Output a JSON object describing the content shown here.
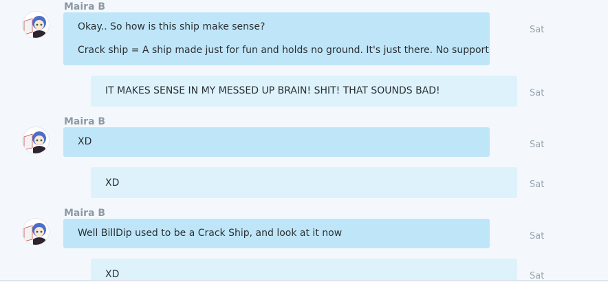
{
  "messages": [
    {
      "sender": "Maira B",
      "lines": [
        "Okay.. So how is this ship make sense?",
        "Crack ship = A ship made just for fun and holds no ground. It's just there. No support"
      ],
      "time": "Sat"
    },
    {
      "lines": [
        "IT MAKES SENSE IN MY MESSED UP BRAIN! SHIT! THAT SOUNDS BAD!"
      ],
      "time": "Sat"
    },
    {
      "sender": "Maira B",
      "lines": [
        "XD"
      ],
      "time": "Sat"
    },
    {
      "lines": [
        "XD"
      ],
      "time": "Sat"
    },
    {
      "sender": "Maira B",
      "lines": [
        "Well BillDip used to be a Crack Ship, and look at it now"
      ],
      "time": "Sat"
    },
    {
      "lines": [
        "XD"
      ],
      "time": "Sat"
    }
  ],
  "icons": {
    "avatar": "anime-avatar-icon"
  },
  "colors": {
    "incoming_bubble": "#bfe6f8",
    "outgoing_bubble": "#ddf2fa",
    "background": "#f4f8fc"
  }
}
